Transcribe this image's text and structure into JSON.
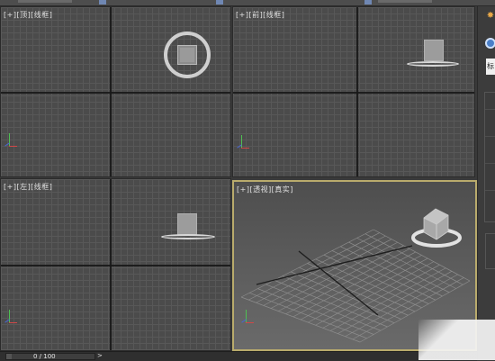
{
  "viewports": {
    "top": {
      "label": "[+][顶][线框]"
    },
    "front": {
      "label": "[+][前][线框]"
    },
    "left": {
      "label": "[+][左][线框]"
    },
    "perspective": {
      "label": "[+][透视][真实]",
      "active": true
    }
  },
  "command_panel": {
    "star_icon": "star-icon",
    "sphere_icon": "sphere-icon",
    "field_text": "标"
  },
  "status_bar": {
    "time_slider": "0 / 100",
    "next_icon": ">",
    "time_slider_progress": 0
  },
  "colors": {
    "viewport_bg": "#4b4b4b",
    "grid_line": "#585858",
    "active_border": "#b9ab6c",
    "axis_x": "#d04848",
    "axis_y": "#4fbf53",
    "axis_z": "#4a66d0",
    "accent": "#4a7fc8"
  }
}
